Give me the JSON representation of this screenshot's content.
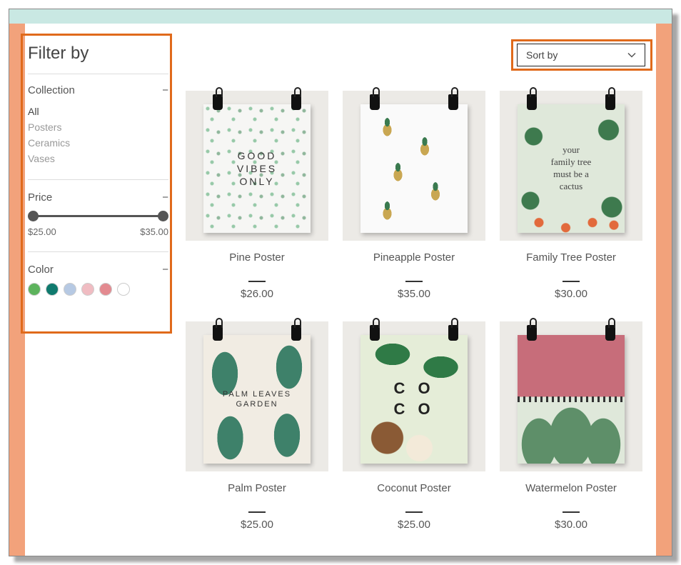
{
  "filter": {
    "title": "Filter by",
    "collection": {
      "label": "Collection",
      "items": [
        "All",
        "Posters",
        "Ceramics",
        "Vases"
      ],
      "active_index": 0
    },
    "price": {
      "label": "Price",
      "min": "$25.00",
      "max": "$35.00"
    },
    "color": {
      "label": "Color",
      "swatches": [
        "#5db35d",
        "#0f7a6e",
        "#b6c9e3",
        "#f0bcc2",
        "#e38a90",
        "#ffffff"
      ]
    }
  },
  "sort": {
    "label": "Sort by"
  },
  "products": [
    {
      "name": "Pine Poster",
      "price": "$26.00",
      "art": "pine",
      "art_text": "GOOD\nVIBES\nONLY"
    },
    {
      "name": "Pineapple Poster",
      "price": "$35.00",
      "art": "pineapple",
      "art_text": ""
    },
    {
      "name": "Family Tree Poster",
      "price": "$30.00",
      "art": "family",
      "art_text": "your\nfamily tree\nmust be a\ncactus"
    },
    {
      "name": "Palm Poster",
      "price": "$25.00",
      "art": "palm",
      "art_text": "PALM LEAVES\nGARDEN"
    },
    {
      "name": "Coconut Poster",
      "price": "$25.00",
      "art": "coco",
      "art_text": "C O\nC O"
    },
    {
      "name": "Watermelon Poster",
      "price": "$30.00",
      "art": "water",
      "art_text": ""
    }
  ]
}
